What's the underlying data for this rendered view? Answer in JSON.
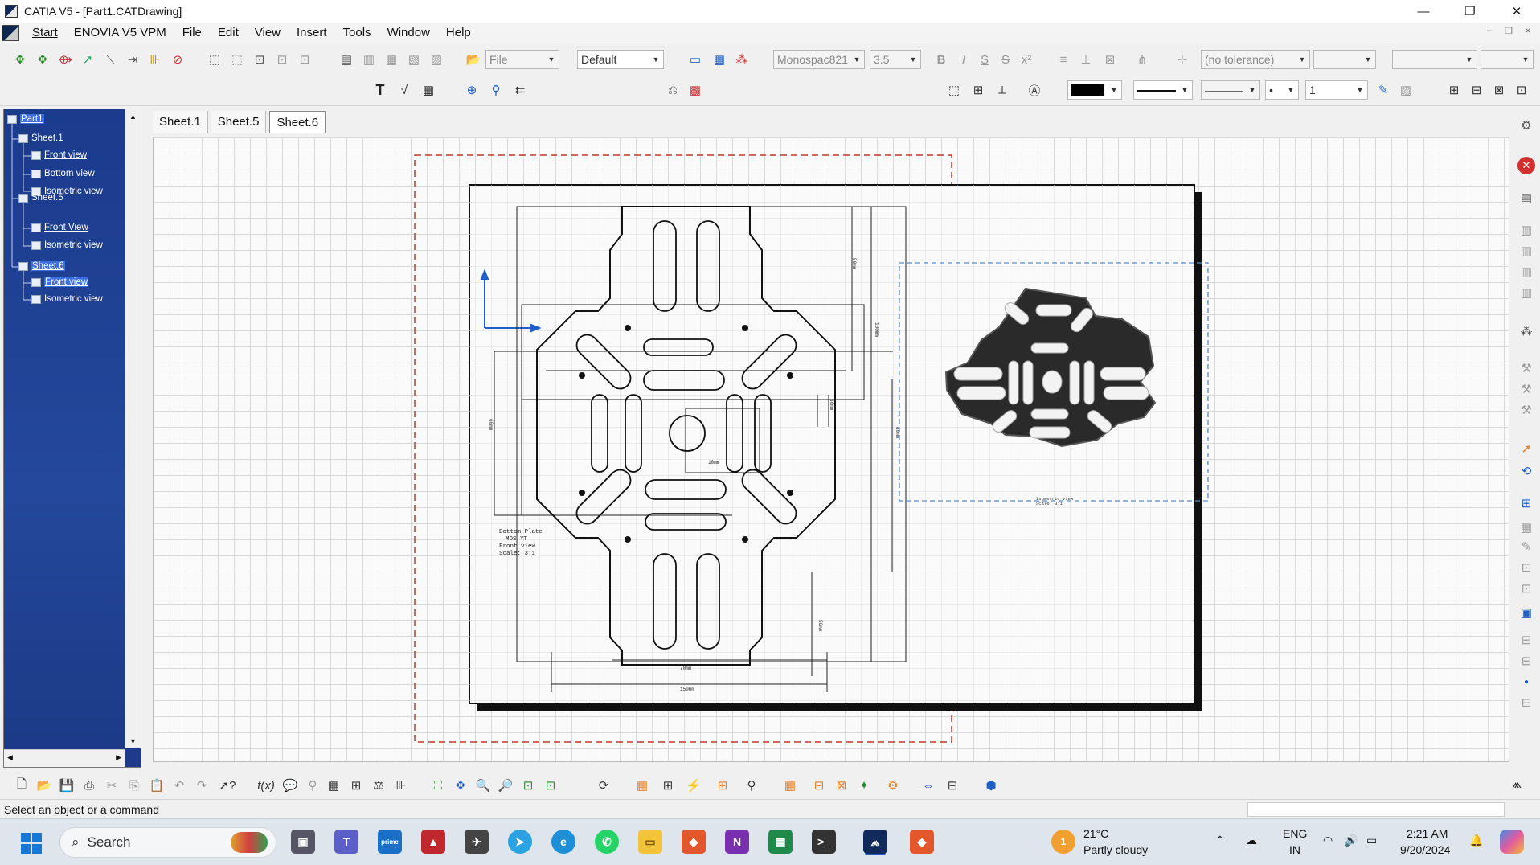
{
  "window": {
    "title": "CATIA V5 - [Part1.CATDrawing]",
    "minimize": "—",
    "restore": "❐",
    "close": "✕"
  },
  "menu": [
    "Start",
    "ENOVIA V5 VPM",
    "File",
    "Edit",
    "View",
    "Insert",
    "Tools",
    "Window",
    "Help"
  ],
  "toolbar": {
    "file_combo": "File",
    "style_combo": "Default",
    "font_combo": "Monospac821",
    "size_combo": "3.5",
    "tolerance_combo": "(no tolerance)",
    "line_weight_value": "1"
  },
  "tree": {
    "root": "Part1",
    "sheets": [
      {
        "label": "Sheet.1",
        "views": [
          "Front view",
          "Bottom view",
          "Isometric view"
        ]
      },
      {
        "label": "Sheet.5",
        "views": [
          "Front View",
          "Isometric view"
        ]
      },
      {
        "label": "Sheet.6",
        "views": [
          "Front view",
          "Isometric view"
        ]
      }
    ]
  },
  "tabs": [
    {
      "label": "Sheet.1",
      "active": false
    },
    {
      "label": "Sheet.5",
      "active": false
    },
    {
      "label": "Sheet.6",
      "active": true
    }
  ],
  "drawing": {
    "front_caption": [
      "Bottom Plate",
      "MDS YT",
      "Front view",
      "Scale:  3:1"
    ],
    "iso_caption": [
      "Isometric view",
      "Scale: 3:1"
    ],
    "dims": [
      "70mm",
      "150mm",
      "50mm",
      "100mm",
      "80mm",
      "50mm",
      "10mm",
      "30mm",
      "60mm"
    ]
  },
  "status": {
    "message": "Select an object or a command"
  },
  "taskbar": {
    "search_label": "Search",
    "weather_temp": "21°C",
    "weather_desc": "Partly cloudy",
    "weather_badge": "1",
    "lang_1": "ENG",
    "lang_2": "IN",
    "time": "2:21 AM",
    "date": "9/20/2024"
  },
  "colors": {
    "tree_bg": "#1e3a8a",
    "selection": "#3b6fe0",
    "frame_dashed": "#c0392b",
    "view_dashed": "#5b8ac9",
    "axis": "#1f5fc7"
  }
}
